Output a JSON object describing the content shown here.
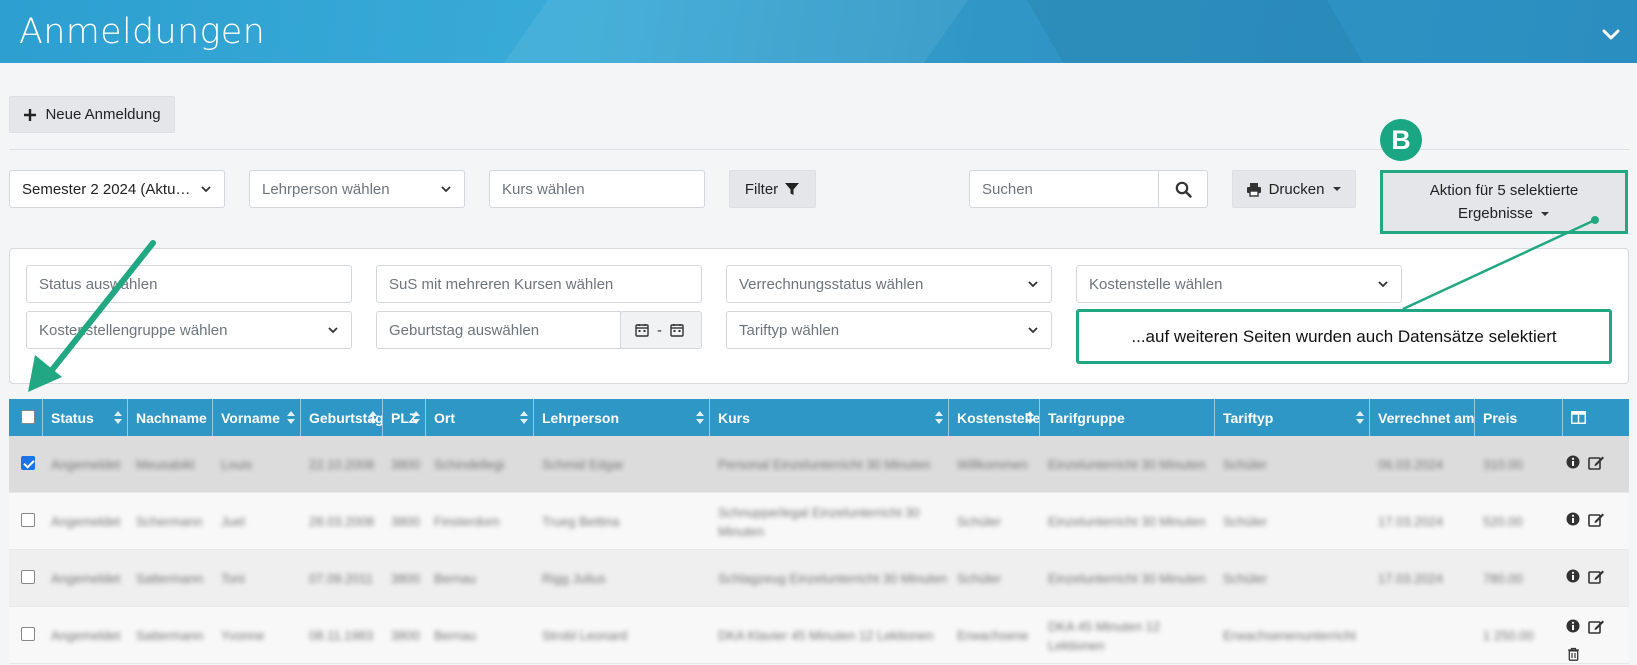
{
  "header": {
    "title": "Anmeldungen"
  },
  "toolbar": {
    "new_label": "Neue Anmeldung"
  },
  "filters_top": {
    "semester": "Semester 2 2024 (Aktu…",
    "teacher_placeholder": "Lehrperson wählen",
    "course_placeholder": "Kurs wählen",
    "filter_label": "Filter",
    "search_placeholder": "Suchen",
    "print_label": "Drucken",
    "action_line1": "Aktion für 5 selektierte",
    "action_line2": "Ergebnisse"
  },
  "filters_panel": {
    "status": "Status auswählen",
    "multi_course": "SuS mit mehreren Kursen wählen",
    "billing_status": "Verrechnungsstatus wählen",
    "cost_center": "Kostenstelle wählen",
    "cost_center_group": "Kostenstellengruppe wählen",
    "birthday": "Geburtstag auswählen",
    "birthday_sep": "-",
    "tariff_type": "Tariftyp wählen"
  },
  "annotation": {
    "badge": "B",
    "callout": "...auf weiteren Seiten wurden auch Datensätze selektiert"
  },
  "table": {
    "columns": [
      "Status",
      "Nachname",
      "Vorname",
      "Geburtstag",
      "PLZ",
      "Ort",
      "Lehrperson",
      "Kurs",
      "Kostenstelle",
      "Tarifgruppe",
      "Tariftyp",
      "Verrechnet am",
      "Preis"
    ],
    "rows": [
      {
        "selected": true,
        "cells": [
          "Angemeldet",
          "Meusabikl",
          "Louis",
          "22.10.2008",
          "3800",
          "Schindellegi",
          "Schmid Edgar",
          "Personal Einzelunterricht 30 Minuten",
          "Willkommen",
          "Einzelunterricht 30 Minuten",
          "Schüler",
          "06.03.2024",
          "310.00"
        ]
      },
      {
        "selected": false,
        "cells": [
          "Angemeldet",
          "Schermann",
          "Juel",
          "28.03.2008",
          "3800",
          "Finsterdorn",
          "Trueg Bettina",
          "Schnupperlegal Einzelunterricht 30 Minuten",
          "Schüler",
          "Einzelunterricht 30 Minuten",
          "Schüler",
          "17.03.2024",
          "520.00"
        ]
      },
      {
        "selected": false,
        "cells": [
          "Angemeldet",
          "Sattermann",
          "Toni",
          "07.09.2011",
          "3800",
          "Bernau",
          "Rigg Julius",
          "Schlagzeug Einzelunterricht 30 Minuten",
          "Schüler",
          "Einzelunterricht 30 Minuten",
          "Schüler",
          "17.03.2024",
          "780.00"
        ]
      },
      {
        "selected": false,
        "cells": [
          "Angemeldet",
          "Sattermann",
          "Yvonne",
          "08.11.1983",
          "3800",
          "Bernau",
          "Strobl Leonard",
          "DKA Klavier 45 Minuten 12 Lektionen",
          "Erwachsene",
          "DKA 45 Minuten 12 Lektionen",
          "Erwachsenenunterricht",
          "",
          "1 250.00"
        ]
      }
    ]
  }
}
